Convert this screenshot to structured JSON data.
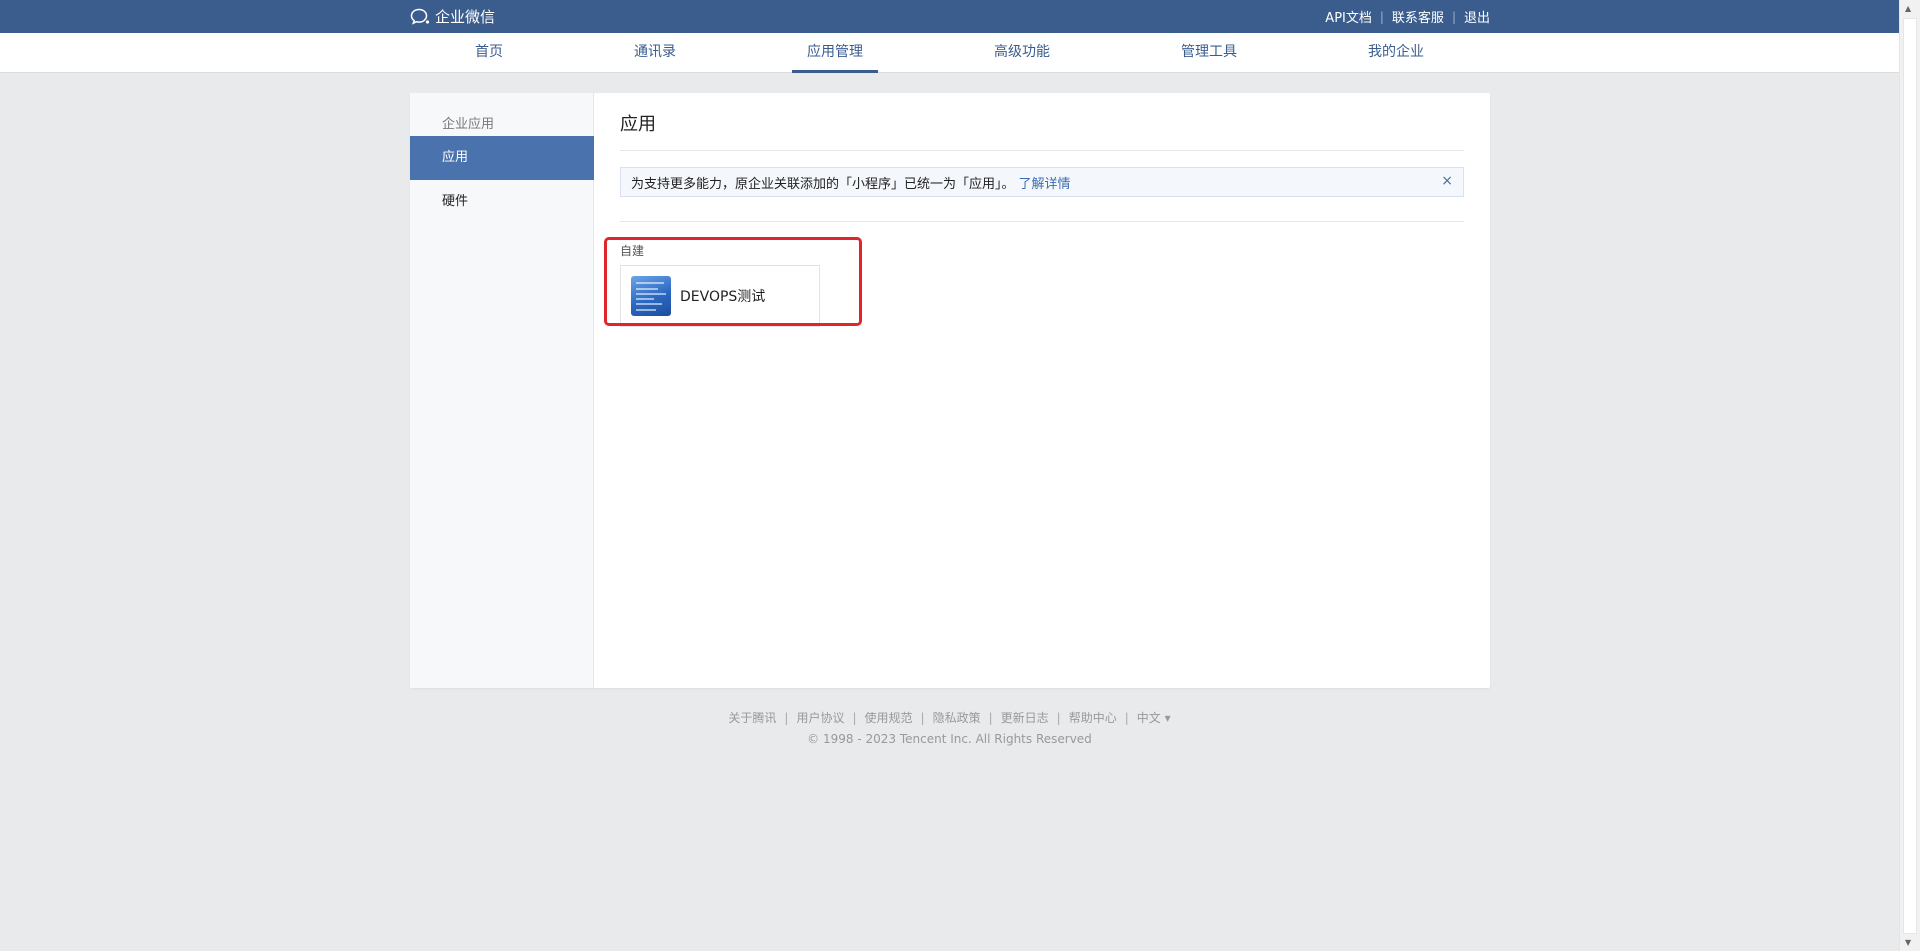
{
  "header": {
    "logo_text": "企业微信",
    "links": [
      "API文档",
      "联系客服",
      "退出"
    ]
  },
  "nav": {
    "items": [
      "首页",
      "通讯录",
      "应用管理",
      "高级功能",
      "管理工具",
      "我的企业"
    ],
    "active": "应用管理"
  },
  "sidebar": {
    "heading": "企业应用",
    "items": [
      "应用",
      "硬件"
    ],
    "active": "应用"
  },
  "main": {
    "title": "应用",
    "notice": {
      "text": "为支持更多能力，原企业关联添加的「小程序」已统一为「应用」。",
      "link": "了解详情",
      "close": "×"
    },
    "section_label": "自建",
    "apps": [
      {
        "name": "DEVOPS测试"
      }
    ]
  },
  "footer": {
    "links": [
      "关于腾讯",
      "用户协议",
      "使用规范",
      "隐私政策",
      "更新日志",
      "帮助中心",
      "中文 ▾"
    ],
    "copyright": "© 1998 - 2023 Tencent Inc. All Rights Reserved"
  },
  "colors": {
    "topbar": "#3a5d8e",
    "sidebar_active": "#4a73ad",
    "highlight": "#e0262c",
    "link": "#3a6cb4"
  }
}
